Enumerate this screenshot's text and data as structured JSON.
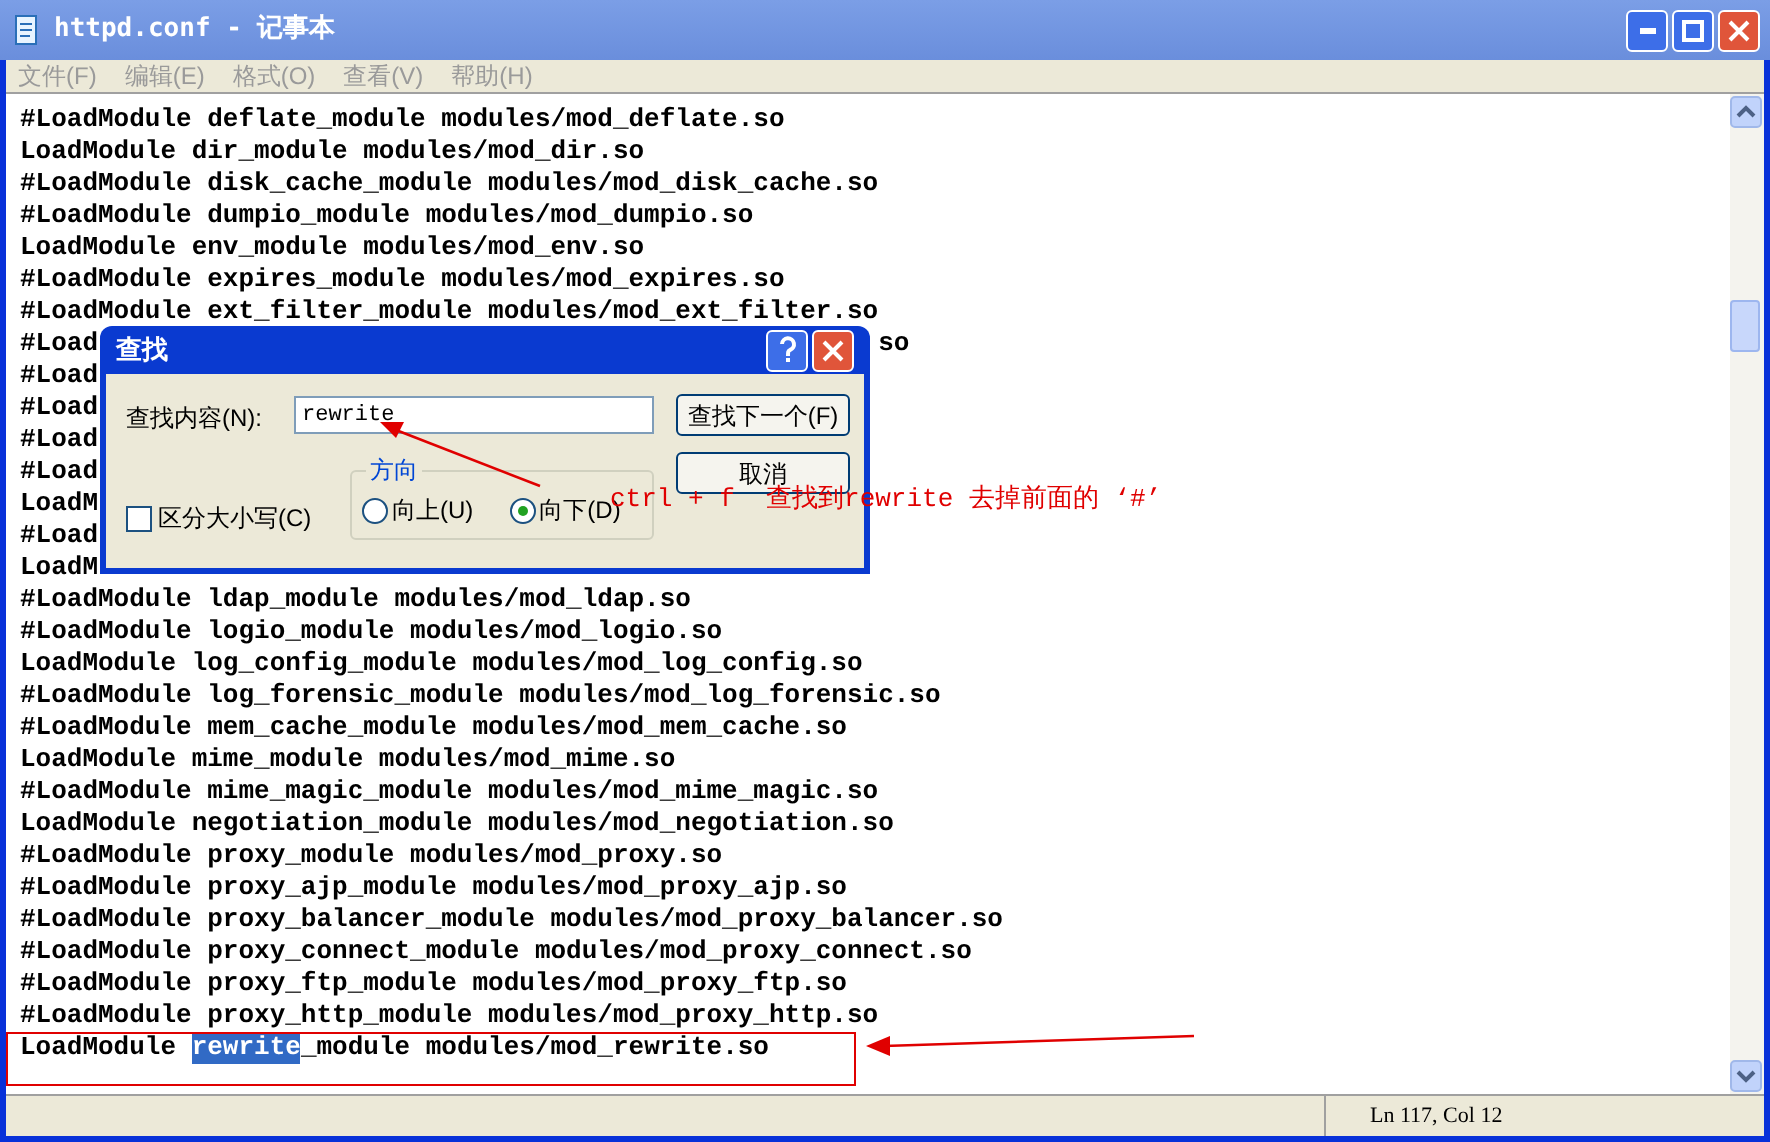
{
  "window": {
    "title": "httpd.conf - 记事本"
  },
  "menu": [
    "文件(F)",
    "编辑(E)",
    "格式(O)",
    "查看(V)",
    "帮助(H)"
  ],
  "lines": [
    {
      "kind": "plain",
      "text": "#LoadModule deflate_module modules/mod_deflate.so"
    },
    {
      "kind": "plain",
      "text": "LoadModule dir_module modules/mod_dir.so"
    },
    {
      "kind": "plain",
      "text": "#LoadModule disk_cache_module modules/mod_disk_cache.so"
    },
    {
      "kind": "plain",
      "text": "#LoadModule dumpio_module modules/mod_dumpio.so"
    },
    {
      "kind": "plain",
      "text": "LoadModule env_module modules/mod_env.so"
    },
    {
      "kind": "plain",
      "text": "#LoadModule expires_module modules/mod_expires.so"
    },
    {
      "kind": "plain",
      "text": "#LoadModule ext_filter_module modules/mod_ext_filter.so"
    },
    {
      "kind": "clipped",
      "text": "#Load",
      "tail": "so"
    },
    {
      "kind": "clipped",
      "text": "#Load"
    },
    {
      "kind": "clipped",
      "text": "#Load"
    },
    {
      "kind": "clipped",
      "text": "#Load"
    },
    {
      "kind": "clipped",
      "text": "#Load"
    },
    {
      "kind": "clipped",
      "text": "LoadM"
    },
    {
      "kind": "clipped",
      "text": "#Load"
    },
    {
      "kind": "clipped",
      "text": "LoadM"
    },
    {
      "kind": "plain",
      "text": "#LoadModule ldap_module modules/mod_ldap.so"
    },
    {
      "kind": "plain",
      "text": "#LoadModule logio_module modules/mod_logio.so"
    },
    {
      "kind": "plain",
      "text": "LoadModule log_config_module modules/mod_log_config.so"
    },
    {
      "kind": "plain",
      "text": "#LoadModule log_forensic_module modules/mod_log_forensic.so"
    },
    {
      "kind": "plain",
      "text": "#LoadModule mem_cache_module modules/mod_mem_cache.so"
    },
    {
      "kind": "plain",
      "text": "LoadModule mime_module modules/mod_mime.so"
    },
    {
      "kind": "plain",
      "text": "#LoadModule mime_magic_module modules/mod_mime_magic.so"
    },
    {
      "kind": "plain",
      "text": "LoadModule negotiation_module modules/mod_negotiation.so"
    },
    {
      "kind": "plain",
      "text": "#LoadModule proxy_module modules/mod_proxy.so"
    },
    {
      "kind": "plain",
      "text": "#LoadModule proxy_ajp_module modules/mod_proxy_ajp.so"
    },
    {
      "kind": "plain",
      "text": "#LoadModule proxy_balancer_module modules/mod_proxy_balancer.so"
    },
    {
      "kind": "plain",
      "text": "#LoadModule proxy_connect_module modules/mod_proxy_connect.so"
    },
    {
      "kind": "plain",
      "text": "#LoadModule proxy_ftp_module modules/mod_proxy_ftp.so"
    },
    {
      "kind": "plain",
      "text": "#LoadModule proxy_http_module modules/mod_proxy_http.so"
    },
    {
      "kind": "selected",
      "text": "LoadModule ",
      "highlight": "rewrite",
      "after": "_module modules/mod_rewrite.so"
    }
  ],
  "status_bar": "Ln 117, Col 12",
  "find_dialog": {
    "title": "查找",
    "label": "查找内容(N):",
    "value": "rewrite",
    "match_case": {
      "label": "区分大小写(C)",
      "checked": false
    },
    "direction": {
      "label": "方向",
      "options": [
        {
          "label": "向上(U)",
          "selected": false
        },
        {
          "label": "向下(D)",
          "selected": true
        }
      ]
    },
    "buttons": [
      "查找下一个(F)",
      "取消"
    ]
  },
  "annotation": "ctrl + f  查找到rewrite 去掉前面的 ‘#’"
}
